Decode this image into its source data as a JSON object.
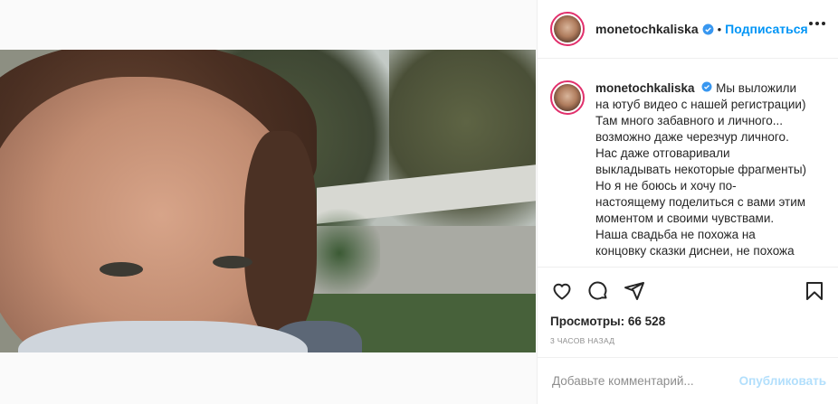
{
  "post": {
    "username": "monetochkaliska",
    "follow_label": "Подписаться",
    "separator": "•",
    "caption_lines": [
      "Мы выложили",
      "на ютуб видео с нашей регистрации)",
      "Там много забавного и личного...",
      "возможно даже черезчур личного.",
      "Нас даже отговаривали",
      "выкладывать некоторые фрагменты)",
      "Но я не боюсь и хочу по-",
      "настоящему поделиться с вами этим",
      "моментом и своими чувствами.",
      "Наша свадьба не похожа на",
      "концовку сказки диснеи, не похожа"
    ],
    "views_label": "Просмотры:",
    "views_count": "66 528",
    "time_ago": "3 часов назад"
  },
  "icons": {
    "verified": "verified-badge-icon",
    "more": "more-options-icon",
    "like": "heart-icon",
    "comment": "comment-icon",
    "share": "share-icon",
    "save": "bookmark-icon",
    "mute": "muted-speaker-icon"
  },
  "comment_box": {
    "placeholder": "Добавьте комментарий...",
    "submit_label": "Опубликовать"
  },
  "colors": {
    "accent": "#0095f6",
    "verified": "#3897f0",
    "story_ring": "#e1306c",
    "publish_disabled": "#b2dffc"
  }
}
